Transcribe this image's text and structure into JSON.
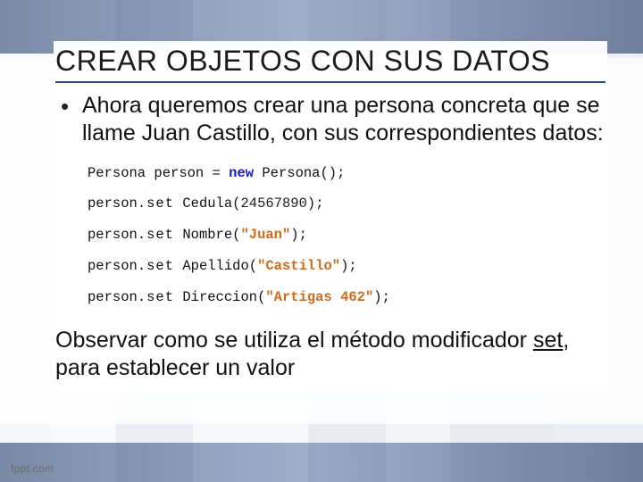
{
  "title": "CREAR OBJETOS CON SUS DATOS",
  "bullet1": "Ahora queremos crear una persona concreta que se llame Juan Castillo, con sus correspondientes datos:",
  "code": {
    "l1_type": "Persona",
    "l1_var": " person ",
    "l1_eq": "= ",
    "l1_new": "new",
    "l1_ctor": " Persona",
    "l1_parens": "();",
    "l2_obj": "person",
    "l2_call": ".set",
    "l2_sep": " ",
    "l2_m": "Cedula",
    "l2_open": "(",
    "l2_arg": "24567890",
    "l2_close": ");",
    "l3_obj": "person",
    "l3_call": ".set",
    "l3_m": "Nombre",
    "l3_open": "(",
    "l3_arg": "\"Juan\"",
    "l3_close": ");",
    "l4_obj": "person",
    "l4_call": ".set",
    "l4_m": "Apellido",
    "l4_open": "(",
    "l4_arg": "\"Castillo\"",
    "l4_close": ");",
    "l5_obj": "person",
    "l5_call": ".set",
    "l5_m": "Direccion",
    "l5_open": "(",
    "l5_arg": "\"Artigas 462\"",
    "l5_close": ");"
  },
  "closing_pre": "Observar como se utiliza el método modificador ",
  "closing_kw": "set",
  "closing_post": ", para establecer un valor",
  "footer": "fppt.com"
}
